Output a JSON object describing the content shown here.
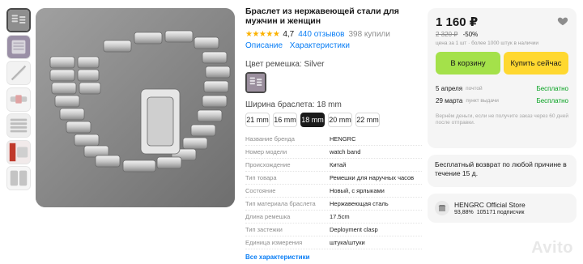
{
  "product": {
    "title": "Браслет из нержавеющей стали для мужчин и женщин",
    "stars": "★★★★★",
    "rating": "4,7",
    "reviews": "440 отзывов",
    "bought": "398 купили",
    "tabs": [
      "Описание",
      "Характеристики"
    ]
  },
  "color": {
    "label": "Цвет ремешка: Silver"
  },
  "width": {
    "label": "Ширина браслета: 18 mm",
    "options": [
      "21 mm",
      "16 mm",
      "18 mm",
      "20 mm",
      "22 mm"
    ],
    "selected": "18 mm"
  },
  "specs": [
    {
      "k": "Название бренда",
      "v": "HENGRC"
    },
    {
      "k": "Номер модели",
      "v": "watch band"
    },
    {
      "k": "Происхождение",
      "v": "Китай"
    },
    {
      "k": "Тип товара",
      "v": "Ремешки для наручных часов"
    },
    {
      "k": "Состояние",
      "v": "Новый, с ярлыками"
    },
    {
      "k": "Тип материала браслета",
      "v": "Нержавеющая сталь"
    },
    {
      "k": "Длина ремешка",
      "v": "17.5cm"
    },
    {
      "k": "Тип застежки",
      "v": "Deployment clasp"
    },
    {
      "k": "Единица измерения",
      "v": "штука/штуки"
    }
  ],
  "all_specs_link": "Все характеристики",
  "pricing": {
    "price": "1 160 ₽",
    "old_price": "2 320 ₽",
    "discount": "-50%",
    "note": "цена за 1 шт · более 1000 штук в наличии",
    "cart_button": "В корзину",
    "buy_button": "Купить сейчас"
  },
  "delivery": [
    {
      "date": "5 апреля",
      "how": "почтой",
      "cost": "Бесплатно"
    },
    {
      "date": "29 марта",
      "how": "пункт выдачи",
      "cost": "Бесплатно"
    }
  ],
  "disclaimer": "Вернём деньги, если не получите заказ через 60 дней после отправки.",
  "return_policy": "Бесплатный возврат по любой причине в течение 15 д.",
  "store": {
    "name": "HENGRC Official Store",
    "rating": "93,88%",
    "subscribers": "105171 подписчик"
  },
  "watermark": "Avito",
  "colors": {
    "link": "#0a7ef5",
    "star": "#fbb200",
    "cart": "#a4e14a",
    "buy": "#ffd830",
    "free": "#05a11f"
  }
}
